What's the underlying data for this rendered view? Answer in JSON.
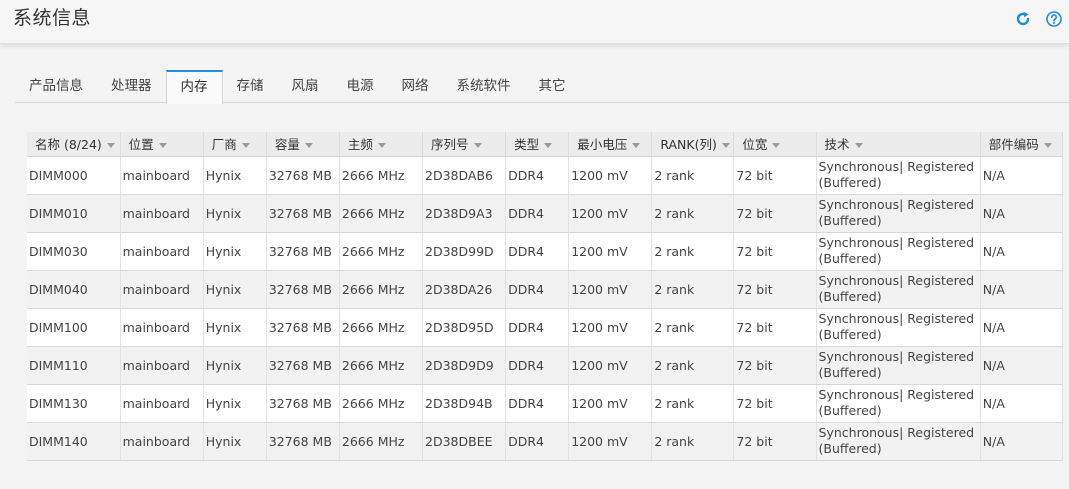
{
  "header": {
    "title": "系统信息"
  },
  "tabs": [
    {
      "label": "产品信息",
      "active": false
    },
    {
      "label": "处理器",
      "active": false
    },
    {
      "label": "内存",
      "active": true
    },
    {
      "label": "存储",
      "active": false
    },
    {
      "label": "风扇",
      "active": false
    },
    {
      "label": "电源",
      "active": false
    },
    {
      "label": "网络",
      "active": false
    },
    {
      "label": "系统软件",
      "active": false
    },
    {
      "label": "其它",
      "active": false
    }
  ],
  "table": {
    "columns": [
      "名称 (8/24)",
      "位置",
      "厂商",
      "容量",
      "主频",
      "序列号",
      "类型",
      "最小电压",
      "RANK(列)",
      "位宽",
      "技术",
      "部件编码"
    ],
    "rows": [
      [
        "DIMM000",
        "mainboard",
        "Hynix",
        "32768 MB",
        "2666 MHz",
        "2D38DAB6",
        "DDR4",
        "1200 mV",
        "2 rank",
        "72 bit",
        "Synchronous| Registered (Buffered)",
        "N/A"
      ],
      [
        "DIMM010",
        "mainboard",
        "Hynix",
        "32768 MB",
        "2666 MHz",
        "2D38D9A3",
        "DDR4",
        "1200 mV",
        "2 rank",
        "72 bit",
        "Synchronous| Registered (Buffered)",
        "N/A"
      ],
      [
        "DIMM030",
        "mainboard",
        "Hynix",
        "32768 MB",
        "2666 MHz",
        "2D38D99D",
        "DDR4",
        "1200 mV",
        "2 rank",
        "72 bit",
        "Synchronous| Registered (Buffered)",
        "N/A"
      ],
      [
        "DIMM040",
        "mainboard",
        "Hynix",
        "32768 MB",
        "2666 MHz",
        "2D38DA26",
        "DDR4",
        "1200 mV",
        "2 rank",
        "72 bit",
        "Synchronous| Registered (Buffered)",
        "N/A"
      ],
      [
        "DIMM100",
        "mainboard",
        "Hynix",
        "32768 MB",
        "2666 MHz",
        "2D38D95D",
        "DDR4",
        "1200 mV",
        "2 rank",
        "72 bit",
        "Synchronous| Registered (Buffered)",
        "N/A"
      ],
      [
        "DIMM110",
        "mainboard",
        "Hynix",
        "32768 MB",
        "2666 MHz",
        "2D38D9D9",
        "DDR4",
        "1200 mV",
        "2 rank",
        "72 bit",
        "Synchronous| Registered (Buffered)",
        "N/A"
      ],
      [
        "DIMM130",
        "mainboard",
        "Hynix",
        "32768 MB",
        "2666 MHz",
        "2D38D94B",
        "DDR4",
        "1200 mV",
        "2 rank",
        "72 bit",
        "Synchronous| Registered (Buffered)",
        "N/A"
      ],
      [
        "DIMM140",
        "mainboard",
        "Hynix",
        "32768 MB",
        "2666 MHz",
        "2D38DBEE",
        "DDR4",
        "1200 mV",
        "2 rank",
        "72 bit",
        "Synchronous| Registered (Buffered)",
        "N/A"
      ]
    ]
  },
  "colors": {
    "accent": "#1e8fe0",
    "header_bg": "#ececec"
  },
  "icons": {
    "refresh": "refresh-icon",
    "help": "help-icon"
  }
}
